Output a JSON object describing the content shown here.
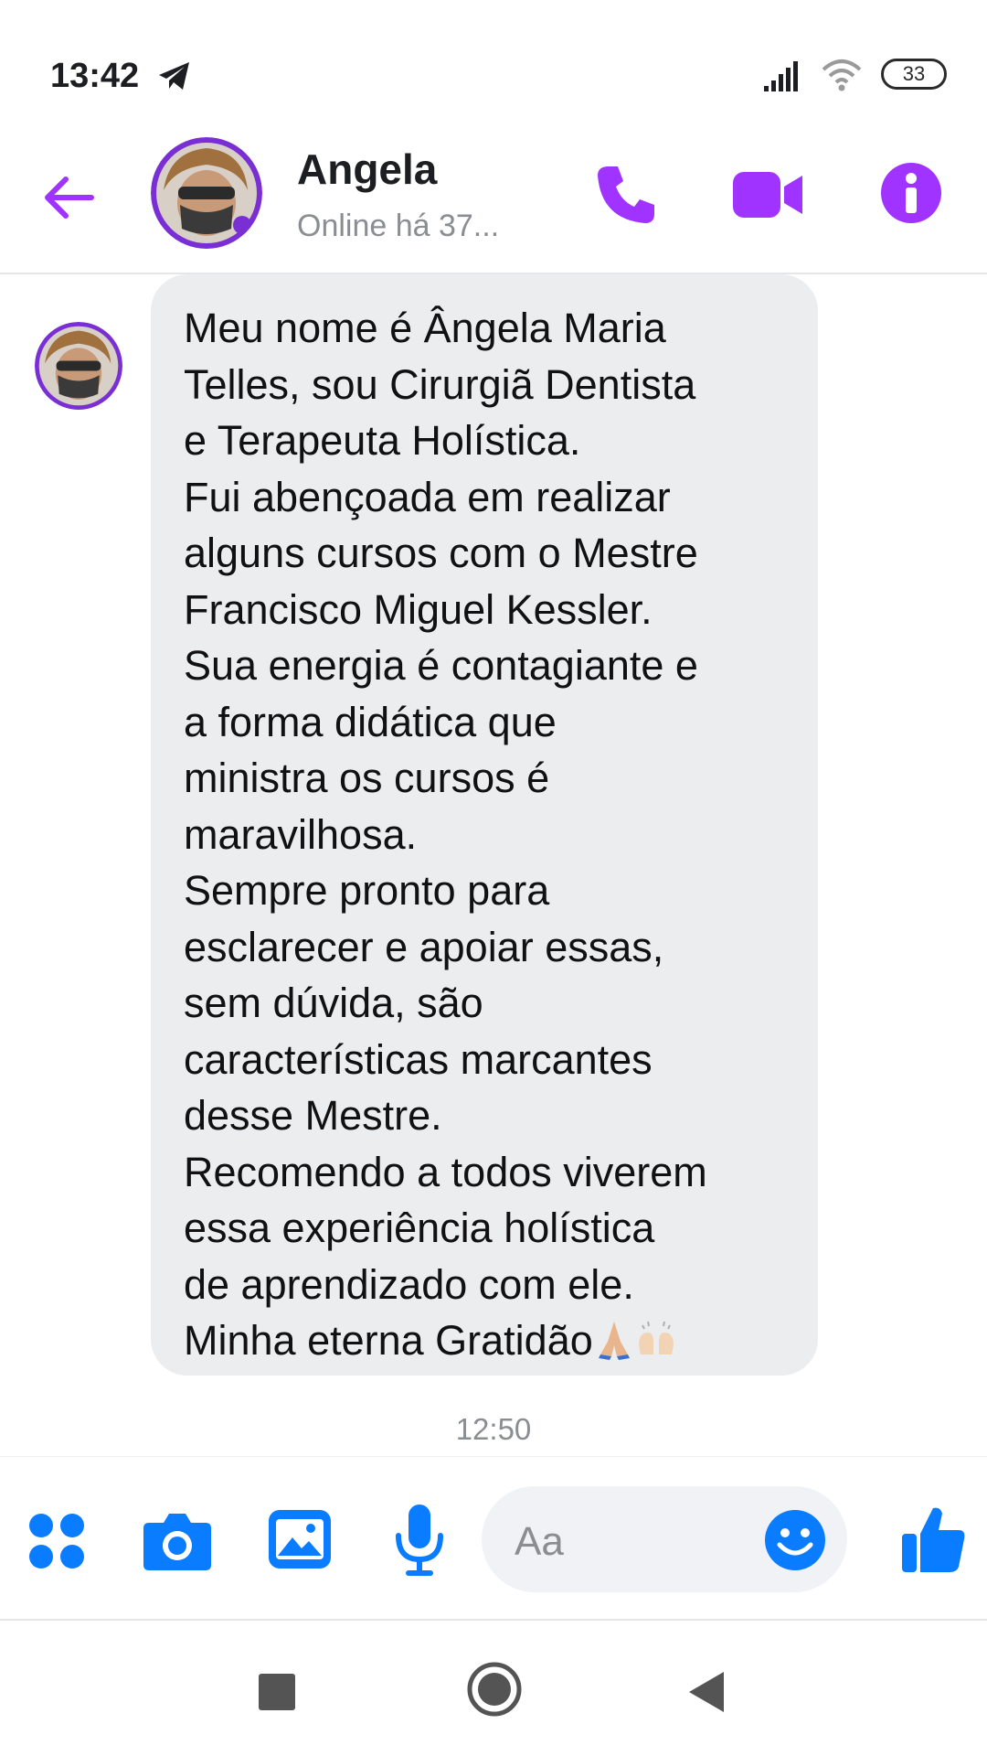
{
  "status_bar": {
    "time": "13:42",
    "battery": "33",
    "icons": [
      "telegram-icon",
      "signal-icon",
      "wifi-icon",
      "battery-icon"
    ]
  },
  "header": {
    "contact_name": "Angela",
    "contact_status": "Online há 37...",
    "icons": [
      "back-arrow-icon",
      "phone-icon",
      "video-camera-icon",
      "info-icon"
    ],
    "accent_color": "#a033ff"
  },
  "message": {
    "text": "Meu nome é Ângela Maria\nTelles, sou Cirurgiã Dentista\ne Terapeuta Holística.\nFui abençoada em realizar\nalguns cursos com o Mestre\nFrancisco Miguel Kessler.\nSua energia é contagiante e\na forma didática que\nministra os cursos é\nmaravilhosa.\nSempre pronto para\nesclarecer e apoiar essas,\nsem dúvida, são\ncaracterísticas marcantes\ndesse Mestre.\nRecomendo a todos viverem\nessa experiência holística\nde aprendizado com ele.\nMinha eterna Gratidão",
    "emojis": [
      "folded-hands-icon",
      "raising-hands-icon"
    ],
    "bubble_color": "#ecedef",
    "timestamp": "12:50"
  },
  "composer": {
    "placeholder": "Aa",
    "icons": [
      "apps-grid-icon",
      "camera-icon",
      "image-icon",
      "microphone-icon",
      "smiley-icon",
      "thumbs-up-icon"
    ],
    "accent_color": "#0a7cff"
  },
  "nav_bar": {
    "icons": [
      "recents-square-icon",
      "home-circle-icon",
      "back-triangle-icon"
    ]
  }
}
